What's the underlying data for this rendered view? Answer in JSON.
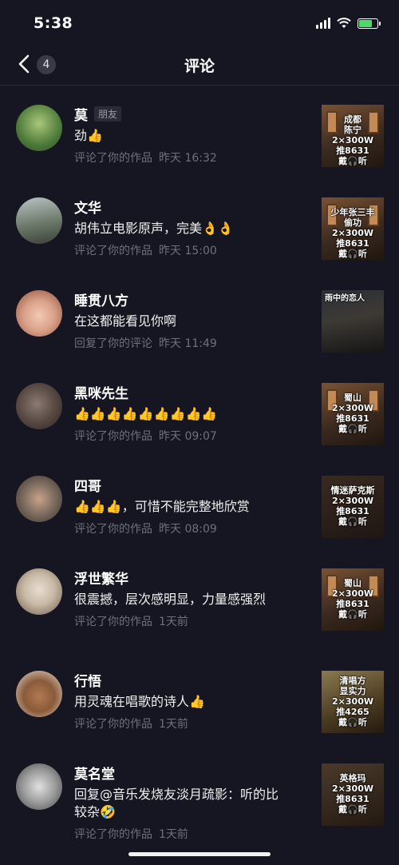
{
  "status": {
    "time": "5:38"
  },
  "header": {
    "back_count": "4",
    "title": "评论"
  },
  "comments": [
    {
      "name": "莫",
      "tag": "朋友",
      "text": "劲👍",
      "action": "评论了你的作品",
      "time": "昨天 16:32",
      "thumb_text": "成都\n陈宁\n2×300W\n推8631\n戴🎧听",
      "avatar_color": "#4d7a3a"
    },
    {
      "name": "文华",
      "tag": "",
      "text": "胡伟立电影原声，完美👌👌",
      "action": "评论了你的作品",
      "time": "昨天 15:00",
      "thumb_text": "少年张三丰\n偷功\n2×300W\n推8631\n戴🎧听",
      "avatar_color": "#6d7a6a"
    },
    {
      "name": "睡贯八方",
      "tag": "",
      "text": "在这都能看见你啊",
      "action": "回复了你的评论",
      "time": "昨天 11:49",
      "thumb_text": "雨中的恋人",
      "avatar_color": "#d9a089"
    },
    {
      "name": "黑咪先生",
      "tag": "",
      "text": "👍👍👍👍👍👍👍👍👍",
      "action": "评论了你的作品",
      "time": "昨天 09:07",
      "thumb_text": "蜀山\n2×300W\n推8631\n戴🎧听",
      "avatar_color": "#5a4a44"
    },
    {
      "name": "四哥",
      "tag": "",
      "text": "👍👍👍，可惜不能完整地欣赏",
      "action": "评论了你的作品",
      "time": "昨天 08:09",
      "thumb_text": "情迷萨克斯\n2×300W\n推8631\n戴🎧听",
      "avatar_color": "#7a6a5e"
    },
    {
      "name": "浮世繁华",
      "tag": "",
      "text": "很震撼，层次感明显，力量感强烈",
      "action": "评论了你的作品",
      "time": "1天前",
      "thumb_text": "蜀山\n2×300W\n推8631\n戴🎧听",
      "avatar_color": "#c8b9a6"
    },
    {
      "name": "行悟",
      "tag": "",
      "text": "用灵魂在唱歌的诗人👍",
      "action": "评论了你的作品",
      "time": "1天前",
      "thumb_text": "清唱方\n显实力\n2×300W\n推4265\n戴🎧听",
      "avatar_color": "#8a5a3a"
    },
    {
      "name": "莫名堂",
      "tag": "",
      "text": "回复@音乐发烧友淡月疏影：听的比较杂🤣",
      "action": "评论了你的作品",
      "time": "1天前",
      "thumb_text": "英格玛\n2×300W\n推8631\n戴🎧听",
      "avatar_color": "#9a9a9a"
    }
  ]
}
